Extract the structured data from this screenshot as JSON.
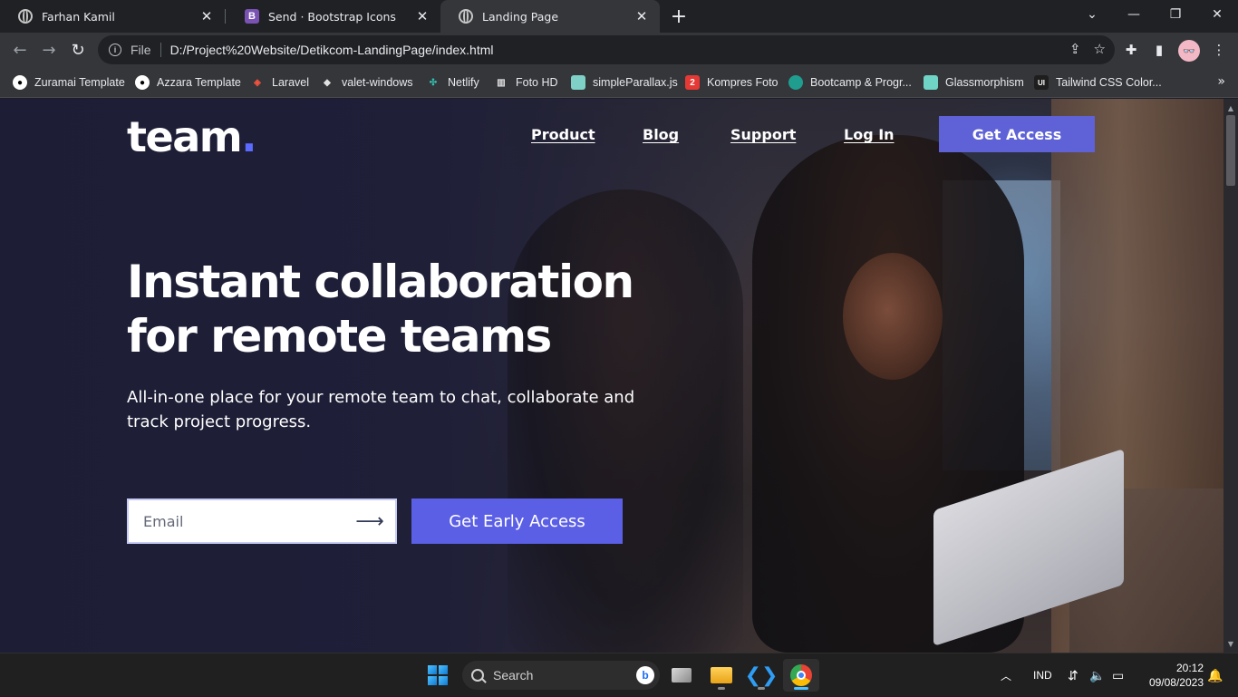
{
  "browser": {
    "tabs": [
      {
        "title": "Farhan Kamil",
        "icon": "globe-icon"
      },
      {
        "title": "Send · Bootstrap Icons",
        "icon": "bootstrap-icon",
        "icon_letter": "B"
      },
      {
        "title": "Landing Page",
        "icon": "globe-icon",
        "active": true
      }
    ],
    "address": {
      "scheme_label": "File",
      "url": "D:/Project%20Website/Detikcom-LandingPage/index.html"
    },
    "bookmarks": [
      {
        "label": "Zuramai Template",
        "icon": "github-icon",
        "color": "#ffffff"
      },
      {
        "label": "Azzara Template",
        "icon": "github-icon",
        "color": "#ffffff"
      },
      {
        "label": "Laravel",
        "icon": "laravel-icon",
        "color": "#f05340"
      },
      {
        "label": "valet-windows",
        "icon": "valet-icon",
        "color": "#e0e0e0"
      },
      {
        "label": "Netlify",
        "icon": "netlify-icon",
        "color": "#32c3b4"
      },
      {
        "label": "Foto HD",
        "icon": "fotohd-icon",
        "color": "#e0e0e0"
      },
      {
        "label": "simpleParallax.js",
        "icon": "parallax-icon",
        "color": "#7fd1c8"
      },
      {
        "label": "Kompres Foto",
        "icon": "kompres-icon",
        "color": "#e53935",
        "letter": "2"
      },
      {
        "label": "Bootcamp & Progr...",
        "icon": "bootcamp-icon",
        "color": "#1f9e8f"
      },
      {
        "label": "Glassmorphism",
        "icon": "glass-icon",
        "color": "#6fd3c6"
      },
      {
        "label": "Tailwind CSS Color...",
        "icon": "ui-icon",
        "color": "#1e1e1e",
        "letter": "UI"
      }
    ]
  },
  "page": {
    "brand": {
      "text": "team",
      "dot": "."
    },
    "nav": [
      "Product",
      "Blog",
      "Support",
      "Log In"
    ],
    "nav_cta": "Get Access",
    "hero_title": "Instant collaboration for remote teams",
    "hero_subtitle": "All-in-one place for your remote team to chat, collaborate and track project progress.",
    "email_placeholder": "Email",
    "cta": "Get Early Access",
    "colors": {
      "accent": "#5b5fe6",
      "background": "#1d1d36"
    }
  },
  "taskbar": {
    "search_placeholder": "Search",
    "language": "IND",
    "time": "20:12",
    "date": "09/08/2023"
  }
}
